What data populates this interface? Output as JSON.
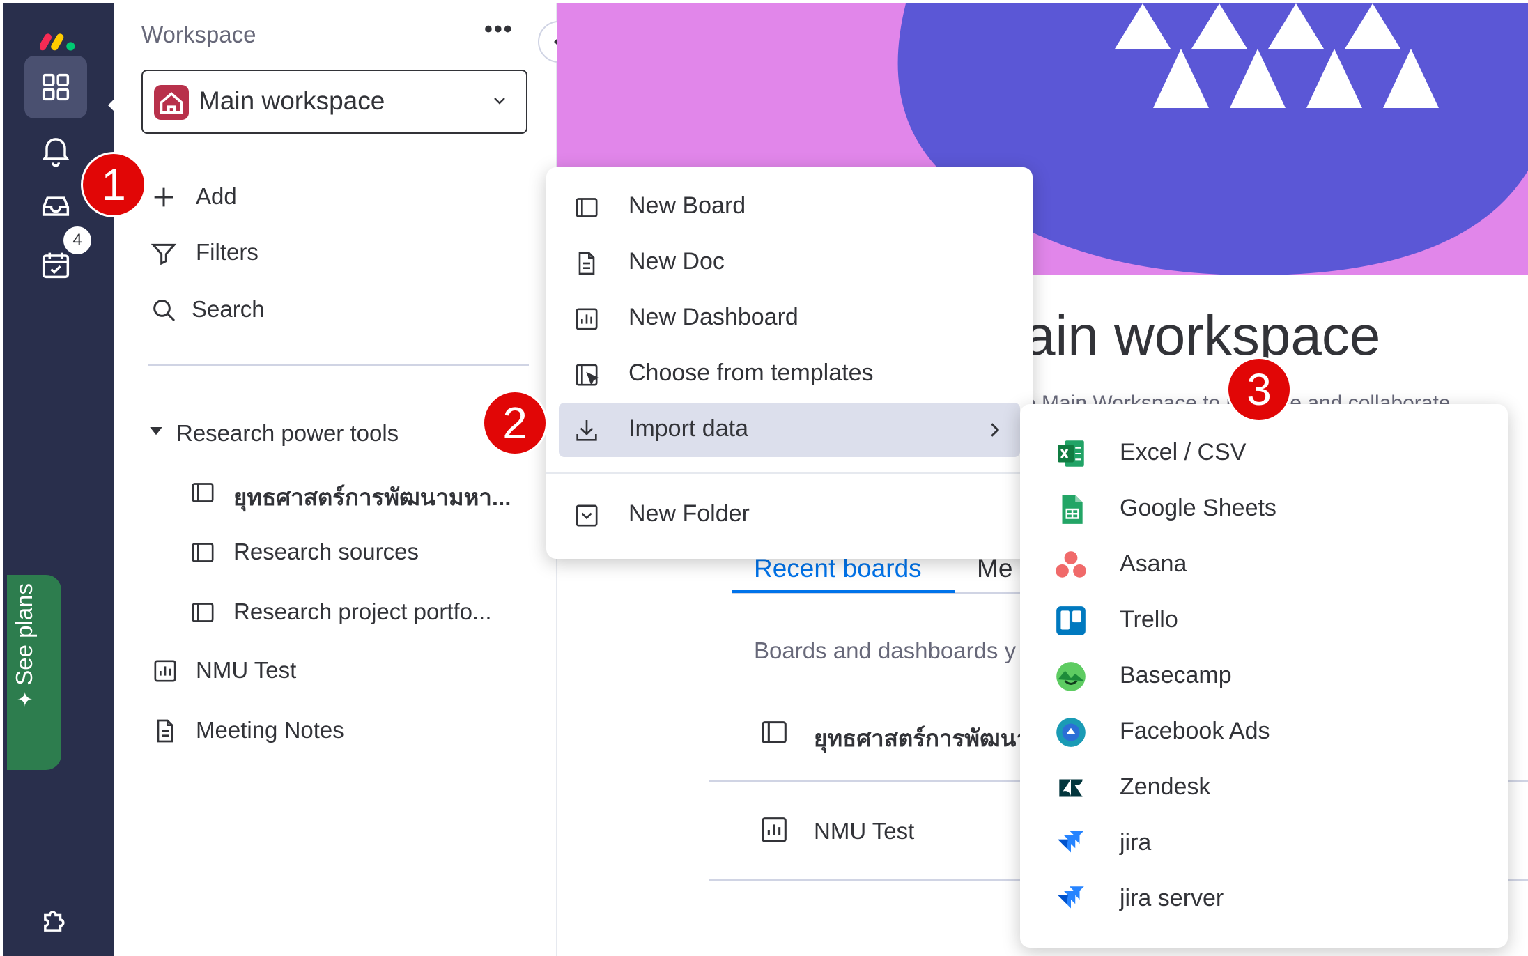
{
  "rail": {
    "inbox_badge": "4",
    "see_plans": "See plans"
  },
  "sidebar": {
    "workspace_label": "Workspace",
    "more": "•••",
    "workspace_selector": "Main workspace",
    "actions": {
      "add": "Add",
      "filters": "Filters",
      "search": "Search"
    },
    "folder": {
      "name": "Research power tools",
      "boards": [
        "ยุทธศาสตร์การพัฒนามหา...",
        "Research sources",
        "Research project portfo..."
      ]
    },
    "items": [
      {
        "label": "NMU Test",
        "icon": "dashboard-icon"
      },
      {
        "label": "Meeting Notes",
        "icon": "doc-icon"
      }
    ]
  },
  "main": {
    "title": "ain workspace",
    "subtitle": "e Main Workspace to manage and collaborate",
    "tabs": [
      "Recent boards",
      "Me"
    ],
    "boards_caption": "Boards and dashboards y",
    "recent": [
      {
        "label": "ยุทธศาสตร์การพัฒนา",
        "icon": "board-icon"
      },
      {
        "label": "NMU Test",
        "icon": "dashboard-icon"
      }
    ]
  },
  "add_menu": {
    "items": [
      {
        "label": "New Board",
        "icon": "board-icon"
      },
      {
        "label": "New Doc",
        "icon": "doc-icon"
      },
      {
        "label": "New Dashboard",
        "icon": "dashboard-icon"
      },
      {
        "label": "Choose from templates",
        "icon": "templates-icon"
      },
      {
        "label": "Import data",
        "icon": "import-icon"
      },
      {
        "label": "New Folder",
        "icon": "folder-icon"
      }
    ]
  },
  "import_menu": {
    "items": [
      {
        "label": "Excel / CSV",
        "icon": "excel-icon",
        "color": "#1d6f42"
      },
      {
        "label": "Google Sheets",
        "icon": "google-sheets-icon",
        "color": "#23a566"
      },
      {
        "label": "Asana",
        "icon": "asana-icon",
        "color": "#f06a6a"
      },
      {
        "label": "Trello",
        "icon": "trello-icon",
        "color": "#0079bf"
      },
      {
        "label": "Basecamp",
        "icon": "basecamp-icon",
        "color": "#5ecc62"
      },
      {
        "label": "Facebook Ads",
        "icon": "facebook-ads-icon",
        "color": "#1877f2"
      },
      {
        "label": "Zendesk",
        "icon": "zendesk-icon",
        "color": "#03363d"
      },
      {
        "label": "jira",
        "icon": "jira-icon",
        "color": "#2684ff"
      },
      {
        "label": "jira server",
        "icon": "jira-server-icon",
        "color": "#2684ff"
      }
    ]
  },
  "steps": [
    "1",
    "2",
    "3"
  ],
  "colors": {
    "rail": "#292f4c",
    "accent": "#0073ea",
    "step_badge": "#e10606",
    "banner_pink": "#e186ea",
    "banner_purple": "#5b57d6",
    "see_plans": "#2d7d4e"
  }
}
